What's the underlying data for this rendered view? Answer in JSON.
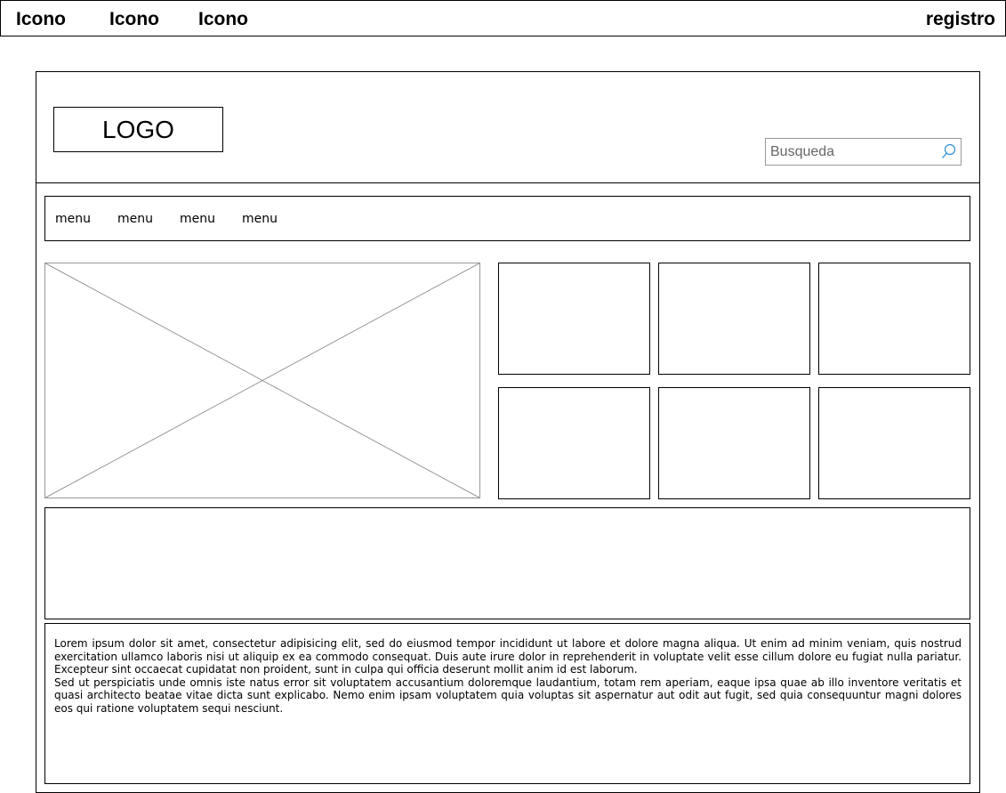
{
  "topbar": {
    "icons": [
      "Icono",
      "Icono",
      "Icono"
    ],
    "register_label": "registro"
  },
  "header": {
    "logo_text": "LOGO",
    "search": {
      "placeholder": "Busqueda",
      "icon": "search-icon"
    }
  },
  "nav": {
    "items": [
      "menu",
      "menu",
      "menu",
      "menu"
    ]
  },
  "content": {
    "hero_image": "image-placeholder",
    "thumbnail_count": 6,
    "paragraphs": [
      "Lorem ipsum dolor sit amet, consectetur adipisicing elit, sed do eiusmod tempor incididunt ut labore et dolore magna aliqua. Ut enim ad minim veniam, quis nostrud exercitation ullamco laboris nisi ut aliquip ex ea commodo consequat. Duis aute irure dolor in reprehenderit in voluptate velit esse cillum dolore eu fugiat nulla pariatur. Excepteur sint occaecat cupidatat non proident, sunt in culpa qui officia deserunt mollit anim id est laborum.",
      "Sed ut perspiciatis unde omnis iste natus error sit voluptatem accusantium doloremque laudantium, totam rem aperiam, eaque ipsa quae ab illo inventore veritatis et quasi architecto beatae vitae dicta sunt explicabo. Nemo enim ipsam voluptatem quia voluptas sit aspernatur aut odit aut fugit, sed quia consequuntur magni dolores eos qui ratione voluptatem sequi nesciunt."
    ]
  },
  "colors": {
    "stroke": "#000000",
    "placeholder_stroke": "#999999",
    "search_icon": "#2a8fd4"
  }
}
